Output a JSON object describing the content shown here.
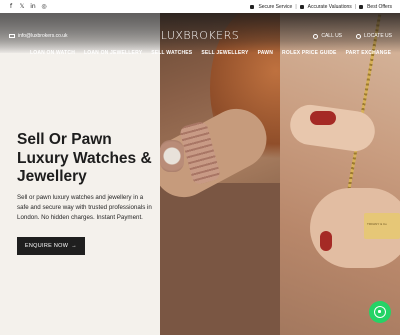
{
  "topbar": {
    "social_icons": [
      "facebook-icon",
      "x-twitter-icon",
      "linkedin-icon",
      "instagram-icon"
    ],
    "social_glyphs": [
      "f",
      "𝕏",
      "in",
      "◎"
    ],
    "trust_items": [
      "Secure Service",
      "Accurate Valuations",
      "Best Offers"
    ],
    "separator": "|"
  },
  "header": {
    "email": "info@luxbrokers.co.uk",
    "logo": "LUXBROKERS",
    "call_label": "CALL US",
    "locate_label": "LOCATE US"
  },
  "nav": {
    "items": [
      "LOAN ON WATCH",
      "LOAN ON JEWELLERY",
      "SELL WATCHES",
      "SELL JEWELLERY",
      "PAWN",
      "ROLEX PRICE GUIDE",
      "PART EXCHANGE"
    ]
  },
  "hero": {
    "title": "Sell Or Pawn Luxury Watches & Jewellery",
    "description": "Sell or pawn luxury watches and jewellery in a safe and secure way with trusted professionals in London. No hidden charges. Instant Payment.",
    "cta_label": "ENQUIRE NOW",
    "cta_arrow": "→",
    "padlock_text": "TIFFANY & Co"
  },
  "colors": {
    "accent_dark": "#1f1f1f",
    "whatsapp": "#25d366",
    "background": "#f4f1ec"
  }
}
